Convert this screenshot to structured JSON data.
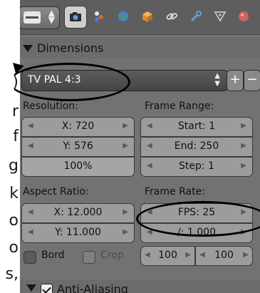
{
  "left_doc_text": [
    ")",
    "r",
    "f",
    "g",
    "k",
    "o",
    "o",
    "s,"
  ],
  "header": {
    "tabs": [
      {
        "icon": "render-camera-icon",
        "active": true
      },
      {
        "icon": "scene-icon"
      },
      {
        "icon": "world-icon"
      },
      {
        "icon": "object-icon"
      },
      {
        "icon": "constraints-icon"
      },
      {
        "icon": "modifiers-icon"
      },
      {
        "icon": "data-icon"
      },
      {
        "icon": "material-icon"
      }
    ]
  },
  "dimensions": {
    "title": "Dimensions",
    "preset": "TV PAL 4:3",
    "resolution_label": "Resolution:",
    "res_x": "X: 720",
    "res_y": "Y: 576",
    "res_pct": "100%",
    "frame_range_label": "Frame Range:",
    "start": "Start: 1",
    "end": "End: 250",
    "step": "Step: 1",
    "aspect_label": "Aspect Ratio:",
    "aspect_x": "X: 12.000",
    "aspect_y": "Y: 11.000",
    "frame_rate_label": "Frame Rate:",
    "fps": "FPS: 25",
    "fps_base": "/: 1.000",
    "bord_label": "Bord",
    "crop_label": "Crop",
    "old": "100",
    "new": "100"
  },
  "anti_aliasing": {
    "title": "Anti-Aliasing"
  }
}
